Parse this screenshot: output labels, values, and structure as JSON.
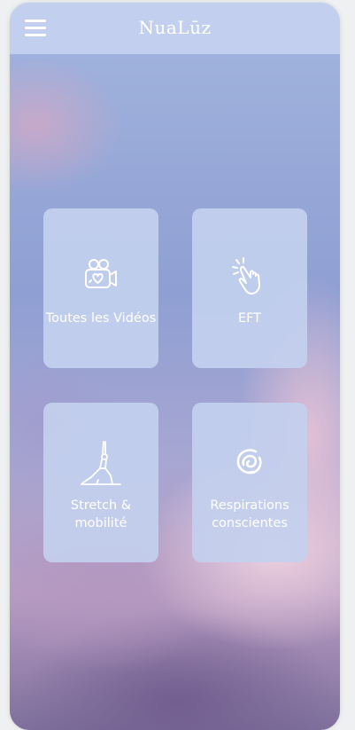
{
  "header": {
    "brand": "NuaLūz",
    "menu_icon": "hamburger-menu-icon"
  },
  "tiles": [
    {
      "label": "Toutes les Vidéos",
      "icon": "video-camera-heart-icon"
    },
    {
      "label": "EFT",
      "icon": "tapping-hand-icon"
    },
    {
      "label_line1": "Stretch &",
      "label_line2": "mobilité",
      "icon": "yoga-pose-icon"
    },
    {
      "label_line1": "Respirations",
      "label_line2": "conscientes",
      "icon": "spiral-breath-icon"
    }
  ],
  "colors": {
    "header_bg": "#c3cfee",
    "tile_bg": "#c3d0ee",
    "text": "#ffffff"
  }
}
